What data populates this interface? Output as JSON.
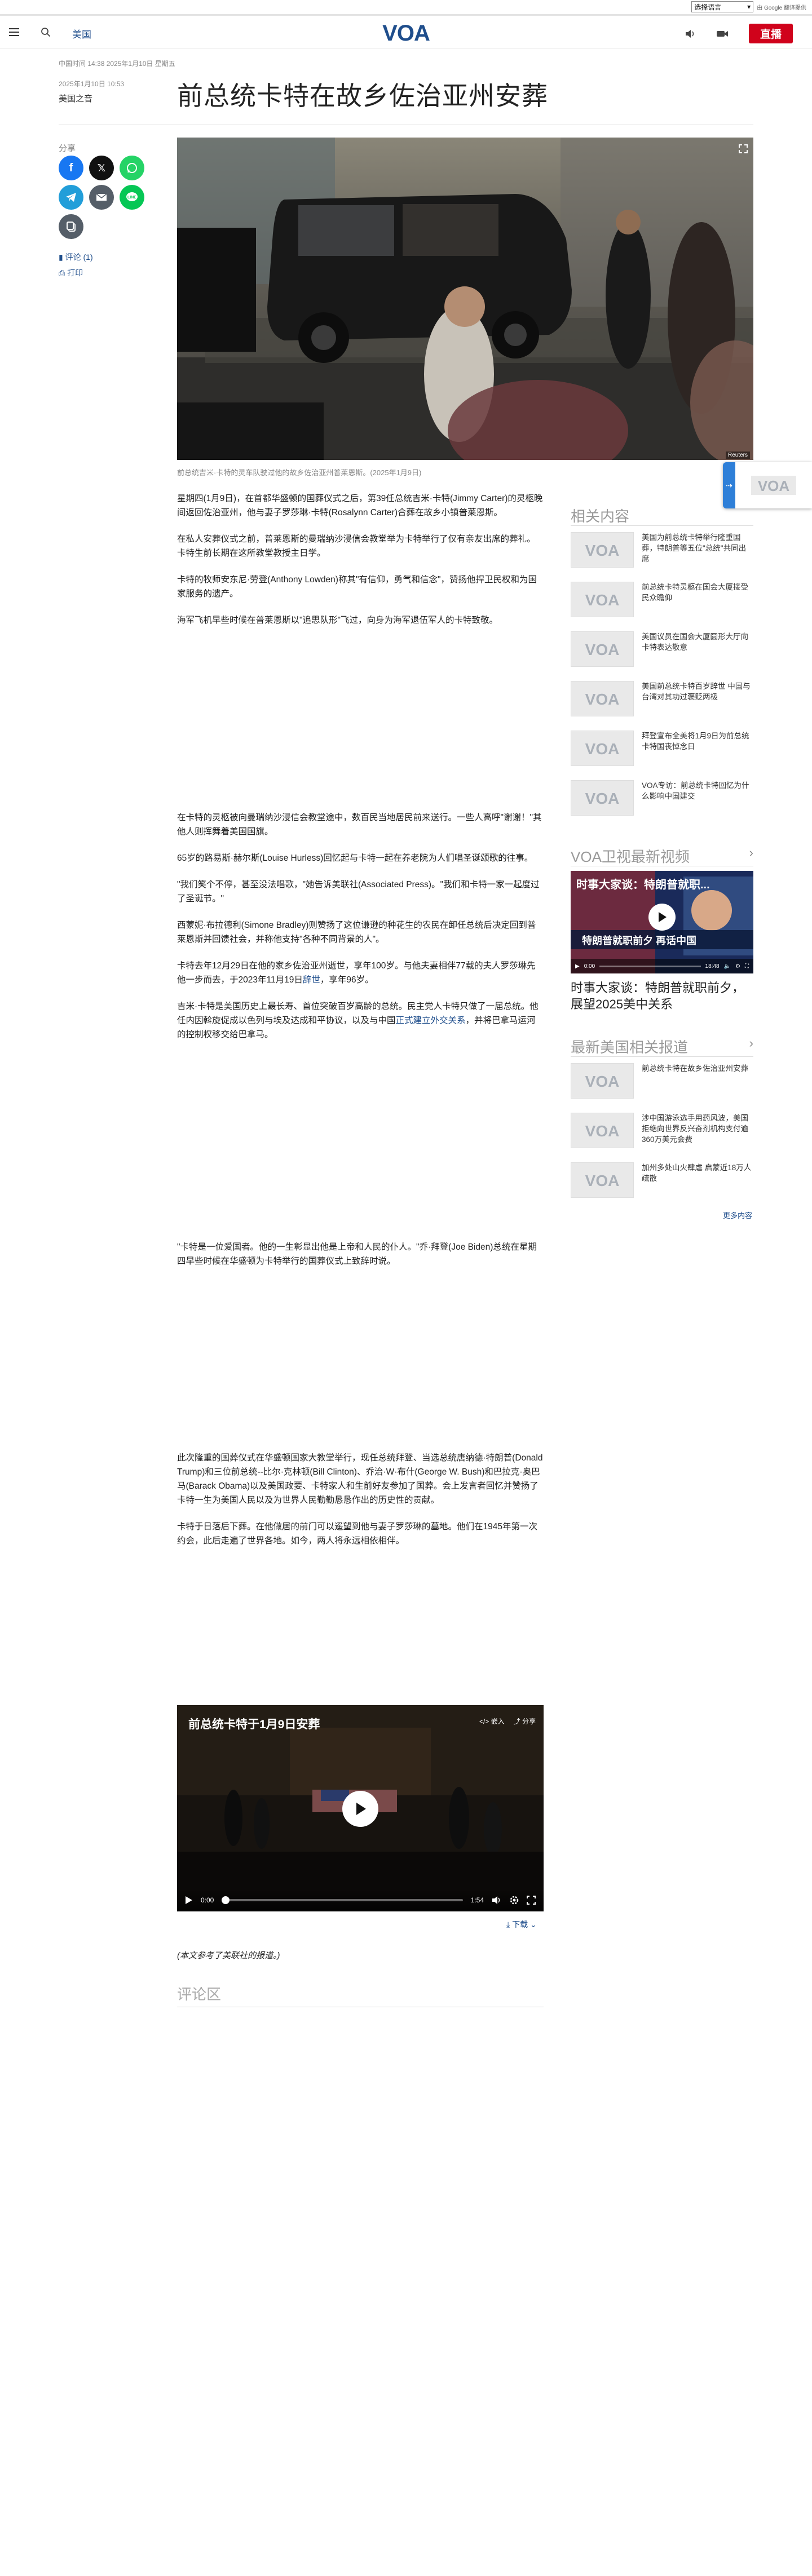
{
  "translate": {
    "select_label": "选择语言",
    "powered_by": "由 Google 翻译提供"
  },
  "header": {
    "section": "美国",
    "logo_text": "VOA",
    "live_label": "直播"
  },
  "meta": {
    "update_line": "中国时间 14:38 2025年1月10日 星期五",
    "pub_date": "2025年1月10日 10:53",
    "author": "美国之音"
  },
  "headline": "前总统卡特在故乡佐治亚州安葬",
  "share": {
    "label": "分享",
    "comments_link": "评论 (1)",
    "print_link": "打印"
  },
  "hero": {
    "caption": "前总统吉米·卡特的灵车队驶过他的故乡佐治亚州普莱恩斯。(2025年1月9日)",
    "credit": "Reuters"
  },
  "article": {
    "p1": "星期四(1月9日)，在首都华盛顿的国葬仪式之后，第39任总统吉米·卡特(Jimmy Carter)的灵柩晚间返回佐治亚州，他与妻子罗莎琳·卡特(Rosalynn Carter)合葬在故乡小镇普莱恩斯。",
    "p2": "在私人安葬仪式之前，普莱恩斯的曼瑞纳沙浸信会教堂举为卡特举行了仅有亲友出席的葬礼。卡特生前长期在这所教堂教授主日学。",
    "p3": "卡特的牧师安东尼·劳登(Anthony Lowden)称其\"有信仰，勇气和信念\"，赞扬他捍卫民权和为国家服务的遗产。",
    "p4": "海军飞机早些时候在普莱恩斯以\"追思队形\"飞过，向身为海军退伍军人的卡特致敬。",
    "p5": "在卡特的灵柩被向曼瑞纳沙浸信会教堂途中，数百民当地居民前来送行。一些人高呼\"谢谢！\"其他人则挥舞着美国国旗。",
    "p6": "65岁的路易斯·赫尔斯(Louise Hurless)回忆起与卡特一起在养老院为人们唱圣诞颂歌的往事。",
    "p7": "\"我们笑个不停，甚至没法唱歌，\"她告诉美联社(Associated Press)。\"我们和卡特一家一起度过了圣诞节。\"",
    "p8": "西蒙妮·布拉德利(Simone Bradley)则赞扬了这位谦逊的种花生的农民在卸任总统后决定回到普莱恩斯并回馈社会，并称他支持\"各种不同背景的人\"。",
    "p9a": "卡特去年12月29日在他的家乡佐治亚州逝世，享年100岁。与他夫妻相伴77载的夫人罗莎琳先他一步而去，于2023年11月19日",
    "p9_link": "辞世",
    "p9b": "，享年96岁。",
    "p10a": "吉米·卡特是美国历史上最长寿、首位突破百岁高龄的总统。民主党人卡特只做了一届总统。他任内因斡旋促成以色列与埃及达成和平协议，以及与中国",
    "p10_link": "正式建立外交关系",
    "p10b": "，并将巴拿马运河的控制权移交给巴拿马。",
    "p11": "\"卡特是一位爱国者。他的一生彰显出他是上帝和人民的仆人。\"乔·拜登(Joe Biden)总统在星期四早些时候在华盛顿为卡特举行的国葬仪式上致辞时说。",
    "p12": "此次隆重的国葬仪式在华盛顿国家大教堂举行，现任总统拜登、当选总统唐纳德·特朗普(Donald Trump)和三位前总统--比尔·克林顿(Bill Clinton)、乔治·W·布什(George W. Bush)和巴拉克·奥巴马(Barack Obama)以及美国政要、卡特家人和生前好友参加了国葬。会上发言者回忆并赞扬了卡特一生为美国人民以及为世界人民勤勤恳恳作出的历史性的贡献。",
    "p13": "卡特于日落后下葬。在他做居的前门可以遥望到他与妻子罗莎琳的墓地。他们在1945年第一次约会，此后走遍了世界各地。如今，两人将永远相依相伴。"
  },
  "player": {
    "title": "前总统卡特于1月9日安葬",
    "embed_label": "嵌入",
    "share_label": "分享",
    "time_current": "0:00",
    "time_total": "1:54",
    "download_label": "下载"
  },
  "source_note": "(本文参考了美联社的报道。)",
  "comments_heading": "评论区",
  "sidebar": {
    "related_heading": "相关内容",
    "related": [
      {
        "title": "美国为前总统卡特举行隆重国葬，特朗普等五位\"总统\"共同出席"
      },
      {
        "title": "前总统卡特灵柩在国会大厦接受民众瞻仰"
      },
      {
        "title": "美国议员在国会大厦圆形大厅向卡特表达敬意"
      },
      {
        "title": "美国前总统卡特百岁辞世 中国与台湾对其功过褒贬两极"
      },
      {
        "title": "拜登宣布全美将1月9日为前总统卡特国丧悼念日"
      },
      {
        "title": "VOA专访：前总统卡特回忆为什么影响中国建交"
      }
    ],
    "video_heading": "VOA卫视最新视频",
    "video_title": "时事大家谈：特朗普就职前夕，展望2025美中关系",
    "video_thumb_top": "时事大家谈：特朗普就职...",
    "video_thumb_banner": "特朗普就职前夕 再话中国",
    "video_time": "0:00",
    "video_total": "18:48",
    "latest_heading": "最新美国相关报道",
    "latest": [
      {
        "title": "前总统卡特在故乡佐治亚州安葬"
      },
      {
        "title": "涉中国游泳选手用药风波，美国拒绝向世界反兴奋剂机构支付逾360万美元会费"
      },
      {
        "title": "加州多处山火肆虐 启蒙近18万人疏散"
      }
    ],
    "more_label": "更多内容"
  },
  "colors": {
    "brand_blue": "#1f4e8c",
    "live_red": "#d0021b",
    "facebook": "#1877f2",
    "x": "#111111",
    "whatsapp": "#25d366",
    "telegram": "#229ed9",
    "email": "#555e68",
    "line": "#06c755",
    "copy": "#555e68"
  }
}
